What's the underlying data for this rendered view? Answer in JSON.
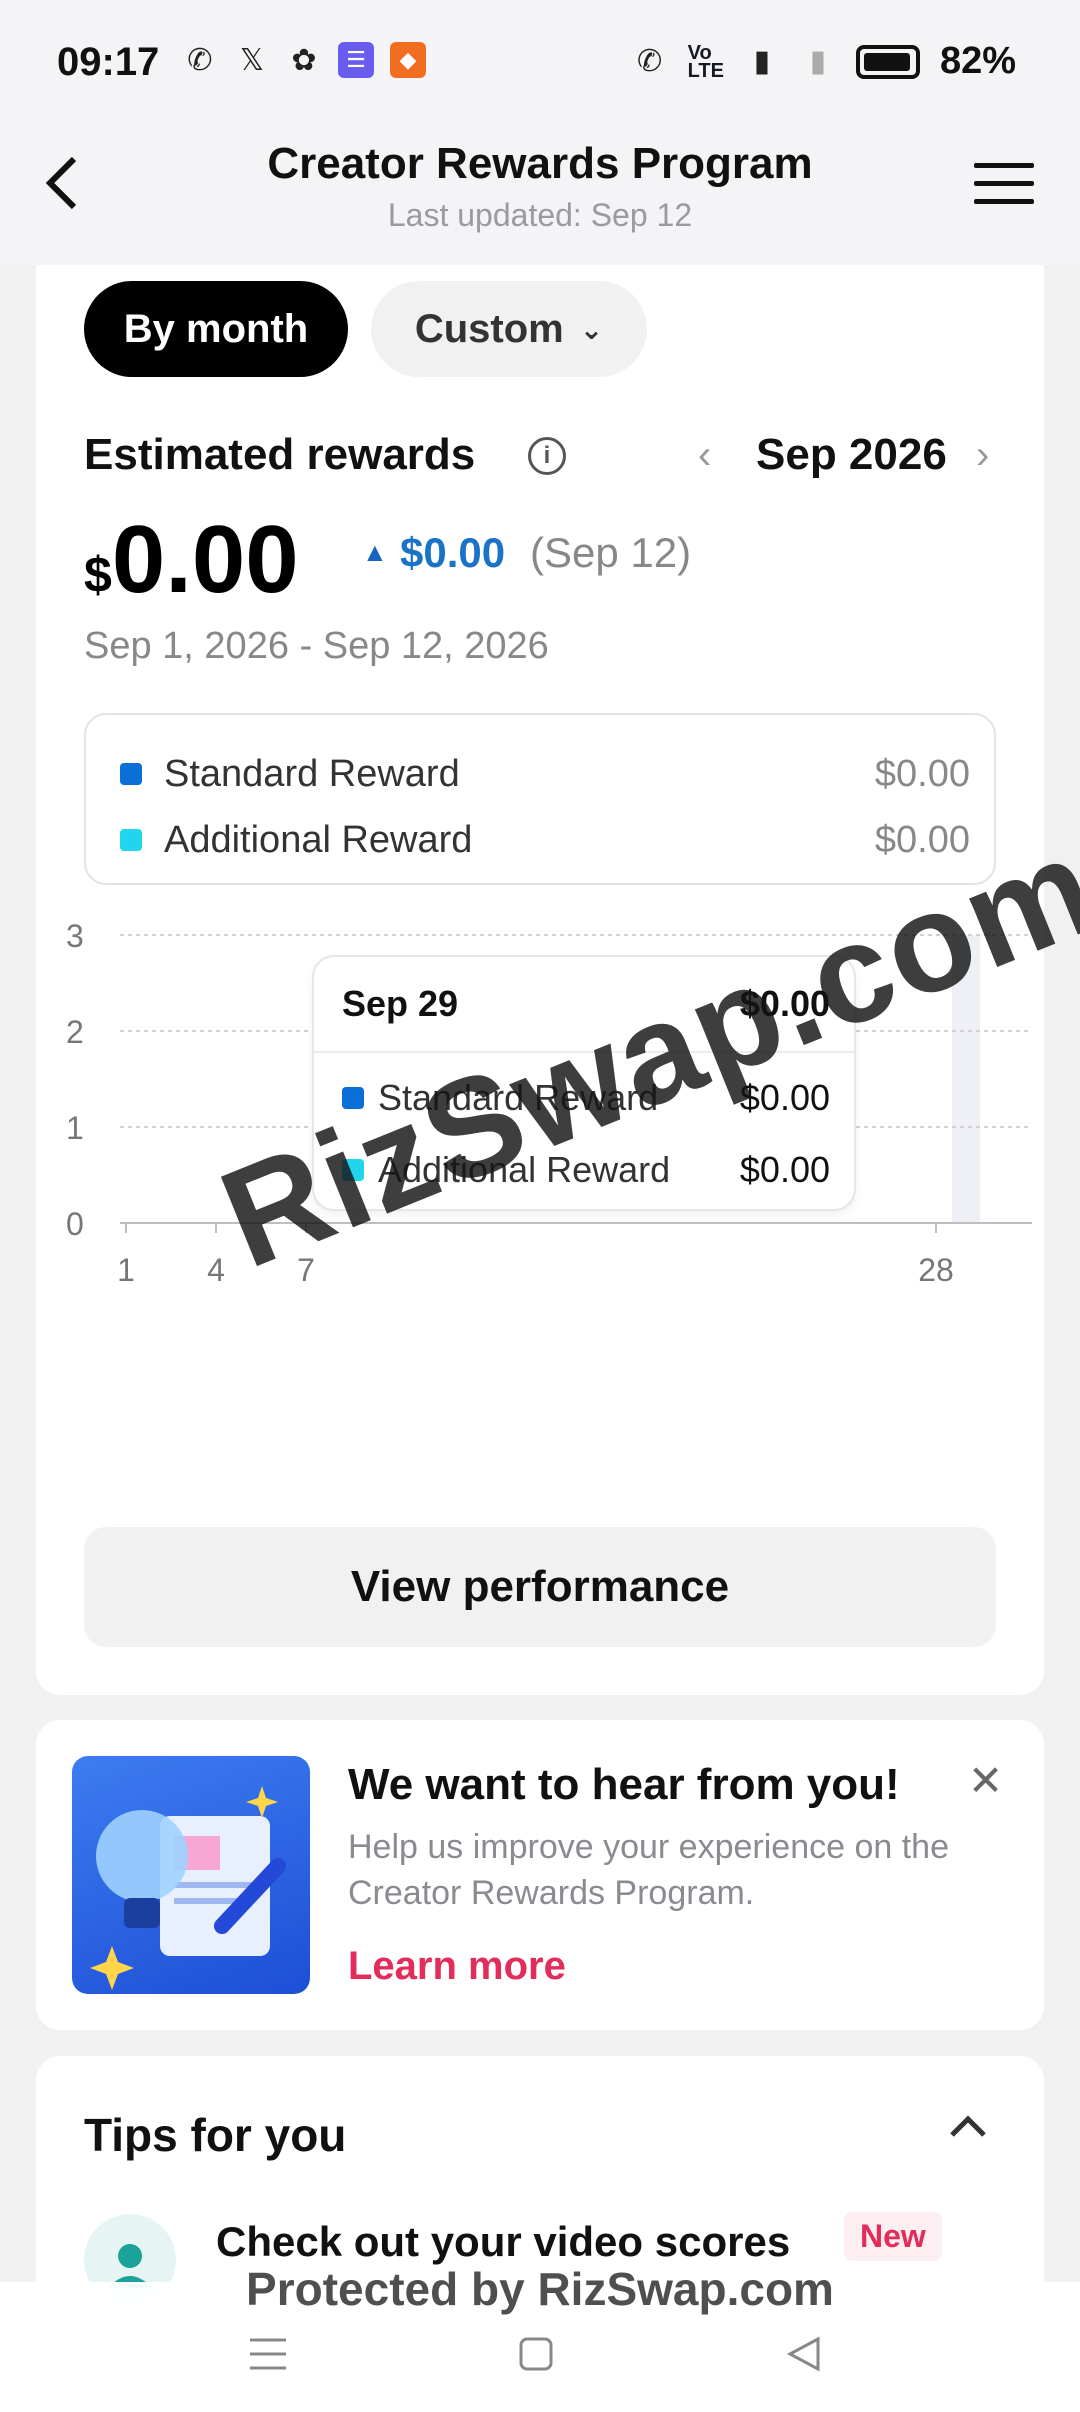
{
  "status_bar": {
    "time": "09:17",
    "battery": "82%"
  },
  "header": {
    "title": "Creator Rewards Program",
    "subtitle": "Last updated: Sep 12"
  },
  "filters": {
    "by_month": "By month",
    "custom": "Custom"
  },
  "rewards": {
    "label": "Estimated rewards",
    "month": "Sep 2026",
    "currency": "$",
    "amount": "0.00",
    "delta": "$0.00",
    "delta_date": "(Sep 12)",
    "range": "Sep 1, 2026 - Sep 12, 2026"
  },
  "legend": [
    {
      "name": "Standard Reward",
      "value": "$0.00",
      "color": "#0a6fd6"
    },
    {
      "name": "Additional Reward",
      "value": "$0.00",
      "color": "#20d5ec"
    }
  ],
  "chart_data": {
    "type": "bar",
    "x": [
      1,
      4,
      7,
      28
    ],
    "y_ticks": [
      0,
      1,
      2,
      3
    ],
    "ylim": [
      0,
      3
    ],
    "series": [
      {
        "name": "Standard Reward",
        "values": [
          0,
          0,
          0,
          0
        ]
      },
      {
        "name": "Additional Reward",
        "values": [
          0,
          0,
          0,
          0
        ]
      }
    ],
    "grid": true
  },
  "tooltip": {
    "date": "Sep 29",
    "total": "$0.00",
    "rows": [
      {
        "name": "Standard Reward",
        "value": "$0.00"
      },
      {
        "name": "Additional Reward",
        "value": "$0.00"
      }
    ]
  },
  "watermark": "RizSwap.com",
  "view_performance": "View performance",
  "feedback": {
    "title": "We want to hear from you!",
    "text": "Help us improve your experience on the Creator Rewards Program.",
    "link": "Learn more"
  },
  "tips": {
    "title": "Tips for you",
    "item_label": "Check out your video scores",
    "item_badge": "New"
  },
  "footer_watermark": "Protected by RizSwap.com"
}
